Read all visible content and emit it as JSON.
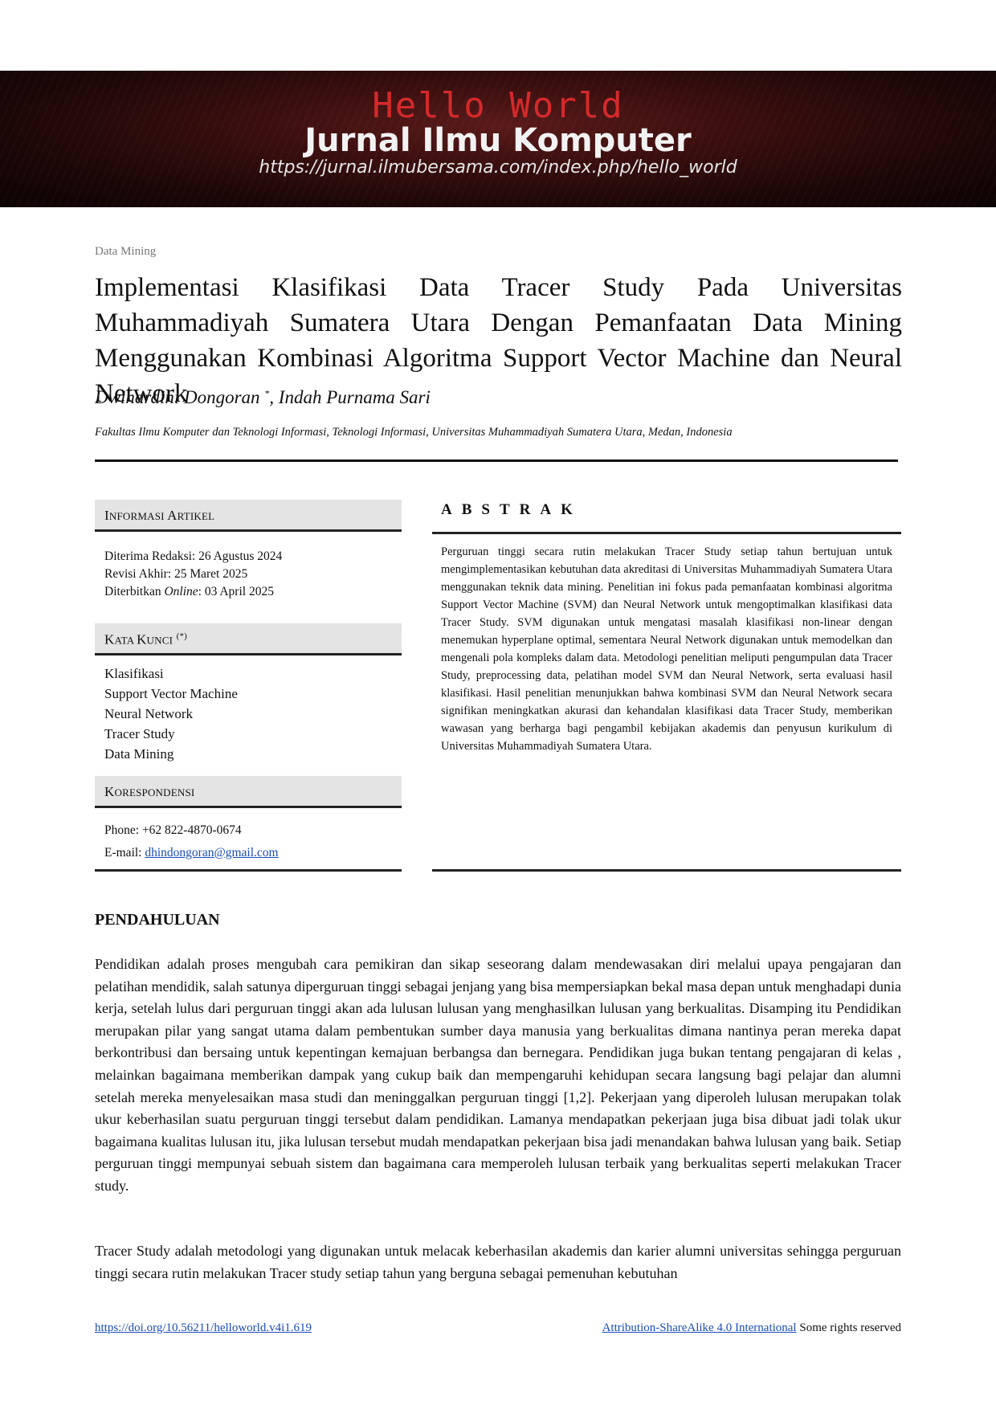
{
  "banner": {
    "title": "Hello World",
    "subtitle": "Jurnal Ilmu Komputer",
    "url": "https://jurnal.ilmubersama.com/index.php/hello_world"
  },
  "category": "Data Mining",
  "title": "Implementasi Klasifikasi Data Tracer Study Pada Universitas Muhammadiyah Sumatera Utara Dengan Pemanfaatan Data Mining Menggunakan Kombinasi Algoritma Support Vector Machine dan Neural Network",
  "authors": {
    "first": "Dwihardini Dongoran ",
    "mark": "*",
    "rest": ", Indah Purnama Sari"
  },
  "affiliation": "Fakultas Ilmu Komputer dan Teknologi Informasi, Teknologi Informasi, Universitas Muhammadiyah Sumatera Utara, Medan, Indonesia",
  "info": {
    "head_cap": "I",
    "head_rest": "NFORMASI ",
    "head_cap2": "A",
    "head_rest2": "RTIKEL",
    "received": "Diterima Redaksi: 26 Agustus 2024",
    "revised": "Revisi Akhir: 25 Maret 2025",
    "published_prefix": "Diterbitkan ",
    "published_online": "Online",
    "published_date": ": 03 April 2025"
  },
  "keywords": {
    "head_cap": "K",
    "head_rest": "ATA ",
    "head_cap2": "K",
    "head_rest2": "UNCI",
    "head_mark": "(*)",
    "items": [
      "Klasifikasi",
      "Support Vector Machine",
      "Neural Network",
      "Tracer Study",
      "Data Mining"
    ]
  },
  "correspondence": {
    "head_cap": "K",
    "head_rest": "ORESPONDENSI",
    "phone": "Phone: +62 822-4870-0674",
    "email_label": "E-mail: ",
    "email": "dhindongoran@gmail.com"
  },
  "abstract": {
    "heading": "ABSTRAK",
    "text": "Perguruan tinggi secara rutin melakukan Tracer Study setiap tahun bertujuan untuk mengimplementasikan kebutuhan data akreditasi di Universitas Muhammadiyah Sumatera Utara menggunakan teknik data mining. Penelitian ini fokus pada pemanfaatan kombinasi algoritma Support Vector Machine (SVM) dan Neural Network untuk mengoptimalkan klasifikasi data Tracer Study. SVM digunakan untuk mengatasi masalah klasifikasi non-linear dengan menemukan hyperplane optimal, sementara Neural Network digunakan untuk memodelkan dan mengenali pola kompleks dalam data. Metodologi penelitian meliputi pengumpulan data Tracer Study, preprocessing data, pelatihan model SVM dan Neural Network, serta evaluasi hasil klasifikasi. Hasil penelitian menunjukkan bahwa kombinasi SVM dan Neural Network secara signifikan meningkatkan akurasi dan kehandalan klasifikasi data Tracer Study, memberikan wawasan yang berharga bagi pengambil kebijakan akademis dan penyusun kurikulum di Universitas Muhammadiyah Sumatera Utara."
  },
  "section": {
    "title": "PENDAHULUAN",
    "para1": "Pendidikan adalah proses mengubah cara pemikiran dan sikap seseorang dalam mendewasakan diri melalui upaya pengajaran dan pelatihan mendidik, salah satunya diperguruan tinggi sebagai jenjang yang bisa mempersiapkan bekal masa depan untuk menghadapi dunia kerja, setelah lulus dari perguruan tinggi akan ada lulusan lulusan yang menghasilkan lulusan yang berkualitas. Disamping itu Pendidikan merupakan pilar yang sangat utama dalam pembentukan sumber daya manusia yang berkualitas dimana nantinya peran mereka dapat berkontribusi dan bersaing untuk kepentingan kemajuan berbangsa dan bernegara. Pendidikan juga bukan tentang pengajaran di kelas , melainkan bagaimana memberikan dampak yang cukup baik dan mempengaruhi kehidupan secara langsung bagi pelajar dan alumni setelah mereka menyelesaikan masa studi dan meninggalkan perguruan tinggi [1,2]. Pekerjaan yang diperoleh lulusan merupakan tolak ukur keberhasilan suatu perguruan tinggi tersebut dalam pendidikan. Lamanya mendapatkan pekerjaan juga bisa dibuat jadi tolak ukur bagaimana kualitas lulusan itu, jika lulusan tersebut mudah mendapatkan pekerjaan bisa jadi menandakan bahwa lulusan yang baik. Setiap perguruan tinggi mempunyai sebuah sistem dan bagaimana cara memperoleh lulusan terbaik yang berkualitas seperti melakukan Tracer study.",
    "para2": "Tracer Study adalah metodologi yang digunakan untuk melacak keberhasilan akademis dan karier alumni universitas sehingga perguruan tinggi secara rutin melakukan Tracer study setiap tahun yang berguna sebagai pemenuhan kebutuhan"
  },
  "footer": {
    "doi": "https://doi.org/10.56211/helloworld.v4i1.619",
    "license": "Attribution-ShareAlike 4.0 International",
    "rights": " Some rights reserved"
  }
}
